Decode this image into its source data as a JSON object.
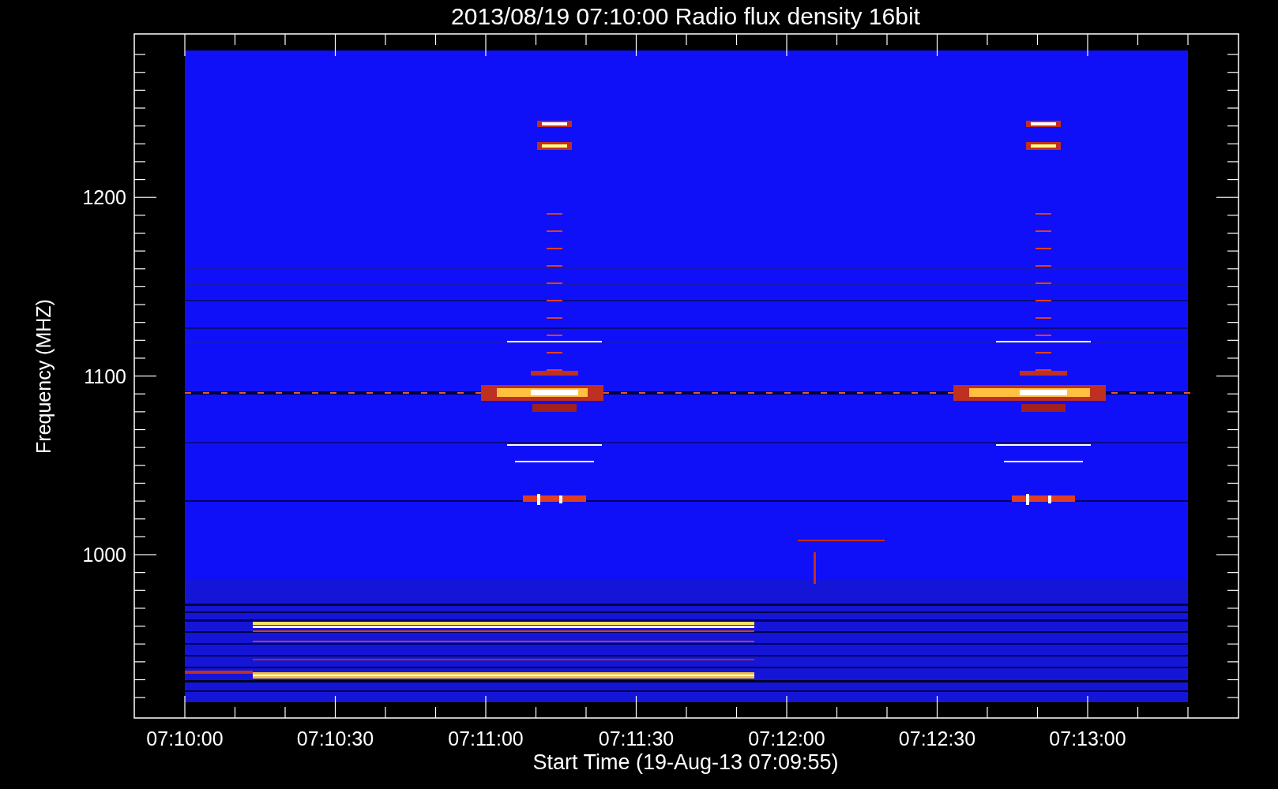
{
  "title": "2013/08/19 07:10:00 Radio flux density 16bit",
  "y_axis": {
    "label": "Frequency (MHZ)",
    "ticks": [
      "1200",
      "1100",
      "1000"
    ]
  },
  "x_axis": {
    "label": "Start Time (19-Aug-13 07:09:55)",
    "ticks": [
      "07:10:00",
      "07:10:30",
      "07:11:00",
      "07:11:30",
      "07:12:00",
      "07:12:30",
      "07:13:00"
    ]
  }
}
